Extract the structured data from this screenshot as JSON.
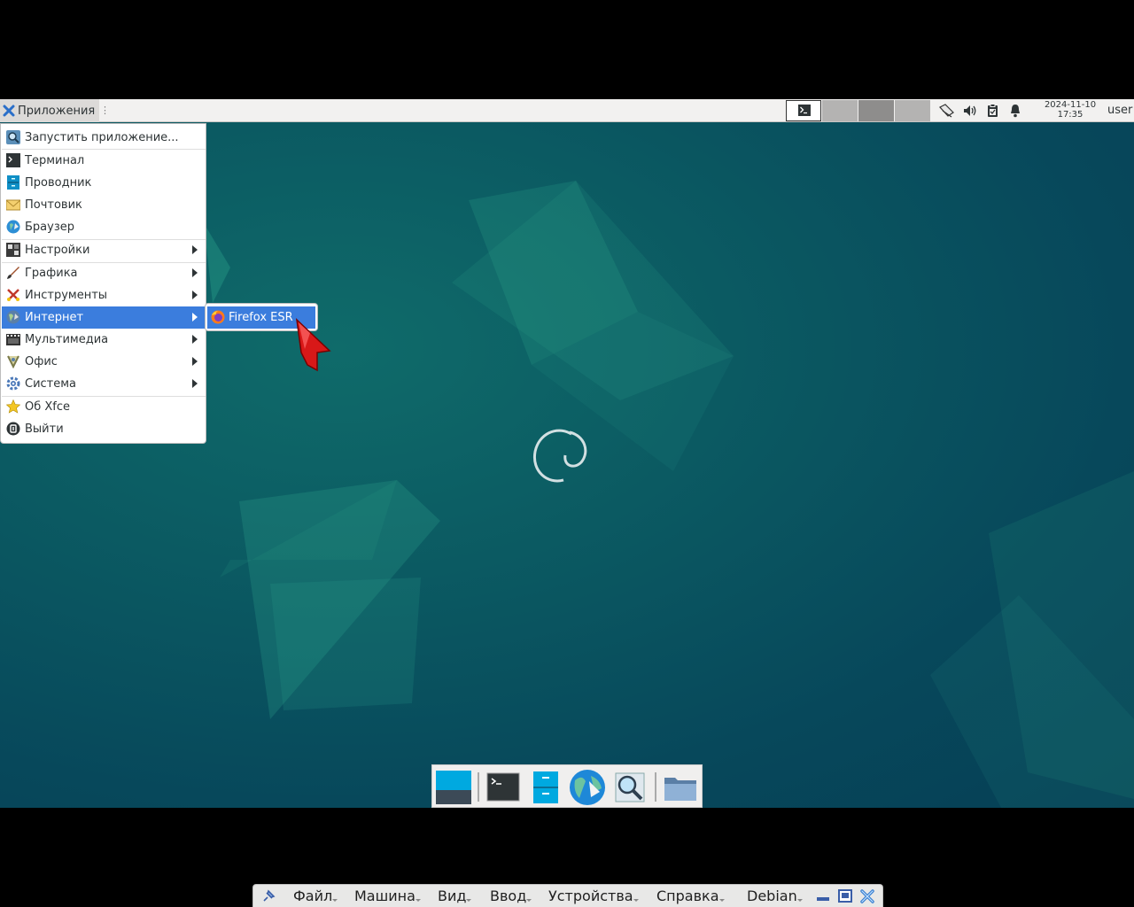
{
  "top_panel": {
    "apps_label": "Приложения",
    "clock": {
      "date": "2024-11-10",
      "time": "17:35"
    },
    "user": "user"
  },
  "app_menu": {
    "items": [
      {
        "label": "Запустить приложение...",
        "icon": "search-icon"
      },
      {
        "label": "Терминал",
        "icon": "terminal-icon"
      },
      {
        "label": "Проводник",
        "icon": "file-manager-icon"
      },
      {
        "label": "Почтовик",
        "icon": "mail-icon"
      },
      {
        "label": "Браузер",
        "icon": "browser-icon"
      },
      {
        "label": "Настройки",
        "icon": "settings-icon",
        "submenu": true
      },
      {
        "label": "Графика",
        "icon": "graphics-icon",
        "submenu": true
      },
      {
        "label": "Инструменты",
        "icon": "tools-icon",
        "submenu": true
      },
      {
        "label": "Интернет",
        "icon": "internet-icon",
        "submenu": true,
        "active": true
      },
      {
        "label": "Мультимедиа",
        "icon": "multimedia-icon",
        "submenu": true
      },
      {
        "label": "Офис",
        "icon": "office-icon",
        "submenu": true
      },
      {
        "label": "Система",
        "icon": "system-icon",
        "submenu": true
      },
      {
        "label": "Об Xfce",
        "icon": "star-icon"
      },
      {
        "label": "Выйти",
        "icon": "logout-icon"
      }
    ]
  },
  "submenu_internet": {
    "items": [
      {
        "label": "Firefox ESR",
        "icon": "firefox-icon"
      }
    ]
  },
  "dock": {
    "items": [
      "show-desktop-icon",
      "terminal-icon",
      "file-manager-icon",
      "browser-icon",
      "app-finder-icon",
      "folder-icon"
    ]
  },
  "vbox_menu": {
    "items": [
      "Файл",
      "Машина",
      "Вид",
      "Ввод",
      "Устройства",
      "Справка",
      "Debian"
    ]
  },
  "colors": {
    "accent": "#3b7ddd",
    "desktop": "#0b5a62",
    "panel": "#f2f1f0"
  }
}
